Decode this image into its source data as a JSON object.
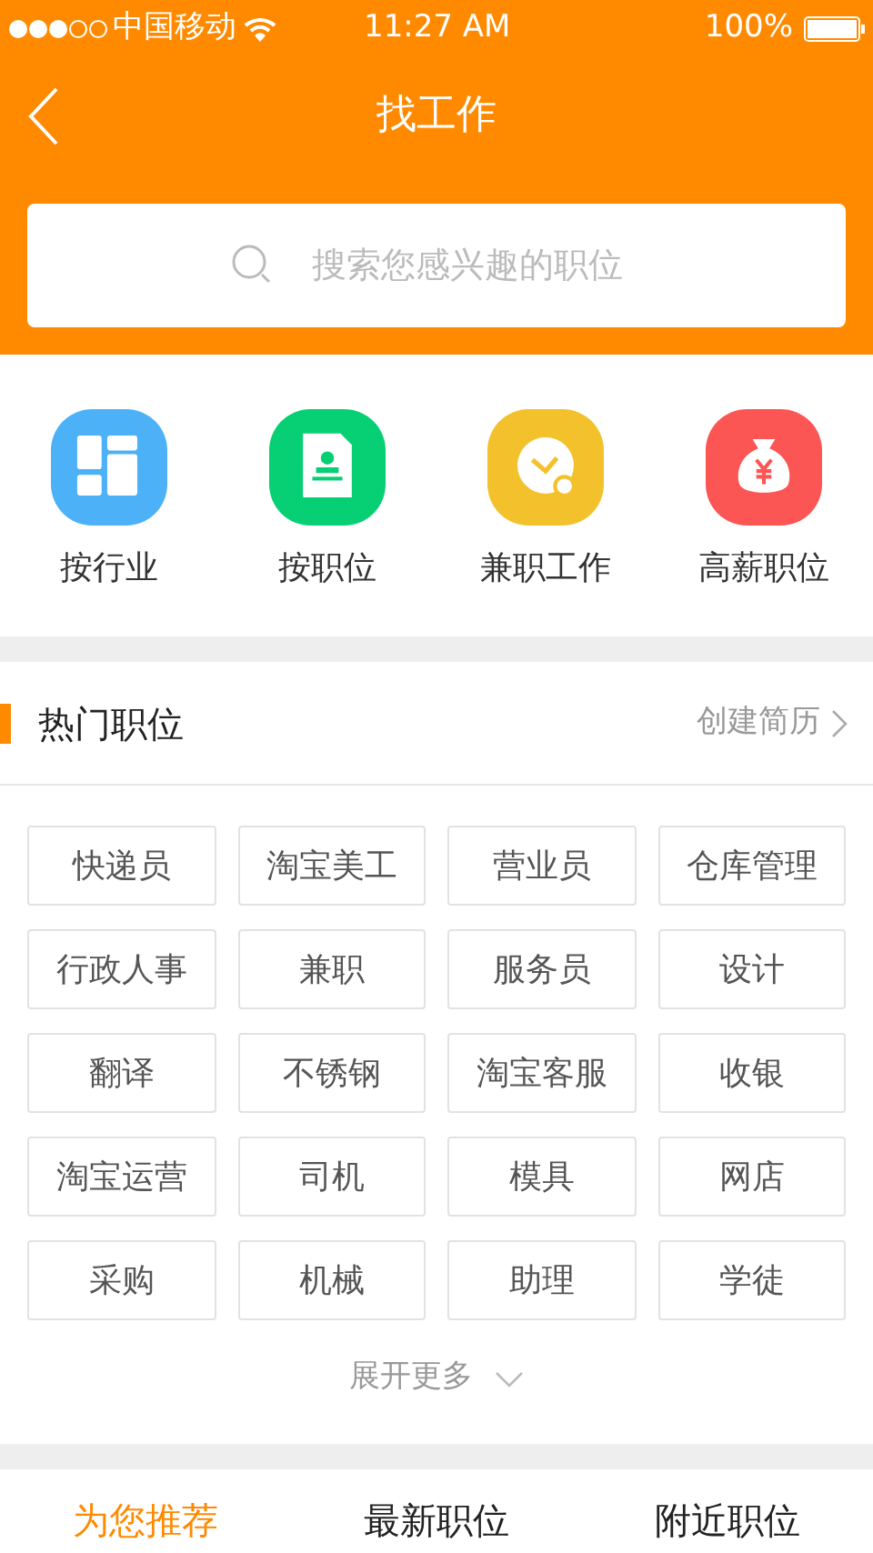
{
  "status_bar": {
    "carrier": "中国移动",
    "time": "11:27 AM",
    "battery": "100%"
  },
  "nav": {
    "title": "找工作"
  },
  "search": {
    "placeholder": "搜索您感兴趣的职位"
  },
  "categories": [
    {
      "label": "按行业",
      "kind": "industry",
      "color": "#4cb1f7"
    },
    {
      "label": "按职位",
      "kind": "position",
      "color": "#07cf73"
    },
    {
      "label": "兼职工作",
      "kind": "parttime",
      "color": "#f3c12b"
    },
    {
      "label": "高薪职位",
      "kind": "salary",
      "color": "#fb5554"
    }
  ],
  "hot_section": {
    "title": "热门职位",
    "link": "创建简历"
  },
  "hot_jobs": [
    "快递员",
    "淘宝美工",
    "营业员",
    "仓库管理",
    "行政人事",
    "兼职",
    "服务员",
    "设计",
    "翻译",
    "不锈钢",
    "淘宝客服",
    "收银",
    "淘宝运营",
    "司机",
    "模具",
    "网店",
    "采购",
    "机械",
    "助理",
    "学徒"
  ],
  "expand": {
    "label": "展开更多"
  },
  "tabs": [
    {
      "label": "为您推荐",
      "selected": true
    },
    {
      "label": "最新职位",
      "selected": false
    },
    {
      "label": "附近职位",
      "selected": false
    }
  ]
}
